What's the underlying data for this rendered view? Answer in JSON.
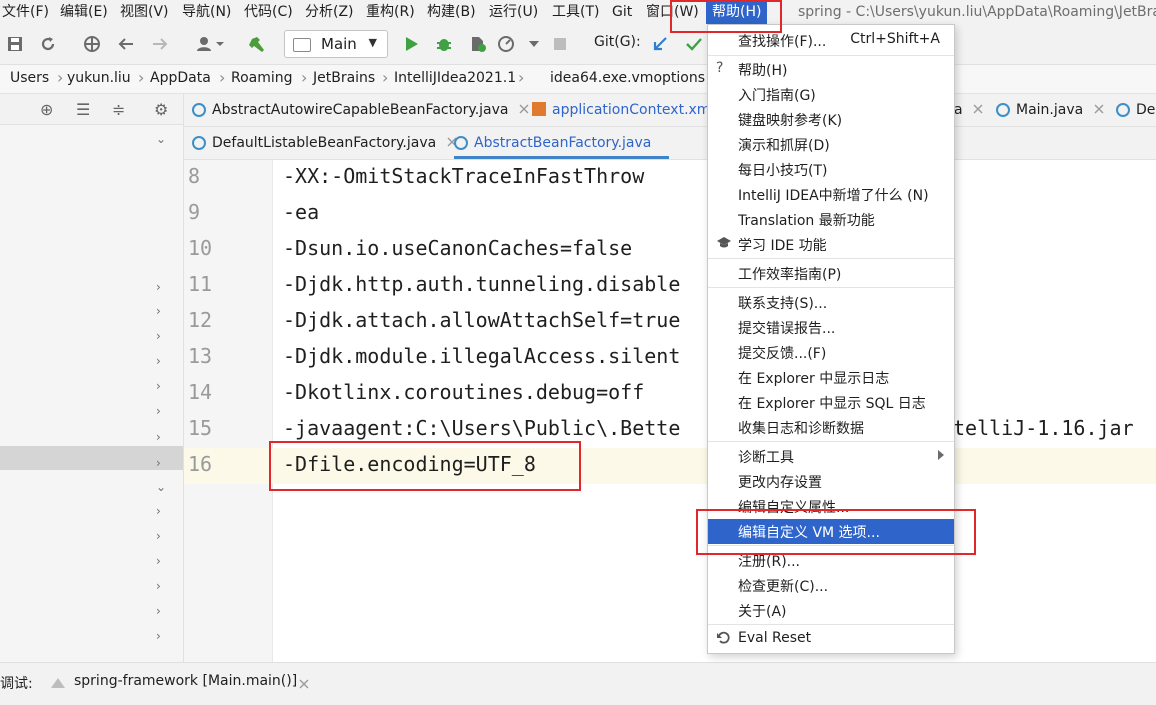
{
  "menubar": {
    "items": [
      "文件(F)",
      "编辑(E)",
      "视图(V)",
      "导航(N)",
      "代码(C)",
      "分析(Z)",
      "重构(R)",
      "构建(B)",
      "运行(U)",
      "工具(T)",
      "Git",
      "窗口(W)",
      "帮助(H)"
    ],
    "window_title": "spring - C:\\Users\\yukun.liu\\AppData\\Roaming\\JetBra"
  },
  "toolbar": {
    "run_config": "Main",
    "git_label": "Git(G):"
  },
  "breadcrumb": [
    "Users",
    "yukun.liu",
    "AppData",
    "Roaming",
    "JetBrains",
    "IntelliJIdea2021.1",
    "idea64.exe.vmoptions"
  ],
  "tabs_row1": [
    "AbstractAutowireCapableBeanFactory.java",
    "applicationContext.xm",
    "a",
    "Main.java",
    "De"
  ],
  "tabs_row2": [
    "DefaultListableBeanFactory.java",
    "AbstractBeanFactory.java"
  ],
  "editor": {
    "lines": [
      {
        "num": "8",
        "text": "-XX:-OmitStackTraceInFastThrow"
      },
      {
        "num": "9",
        "text": "-ea"
      },
      {
        "num": "10",
        "text": "-Dsun.io.useCanonCaches=false"
      },
      {
        "num": "11",
        "text": "-Djdk.http.auth.tunneling.disable"
      },
      {
        "num": "12",
        "text": "-Djdk.attach.allowAttachSelf=true"
      },
      {
        "num": "13",
        "text": "-Djdk.module.illegalAccess.silent"
      },
      {
        "num": "14",
        "text": "-Dkotlinx.coroutines.debug=off"
      },
      {
        "num": "15",
        "text": "-javaagent:C:\\Users\\Public\\.Bette"
      },
      {
        "num": "16",
        "text": "-Dfile.encoding=UTF_8"
      }
    ],
    "line15_tail": "telliJ-1.16.jar"
  },
  "help_menu": {
    "find_action": {
      "label": "查找操作(F)...",
      "shortcut": "Ctrl+Shift+A"
    },
    "items": [
      "帮助(H)",
      "入门指南(G)",
      "键盘映射参考(K)",
      "演示和抓屏(D)",
      "每日小技巧(T)",
      "IntelliJ IDEA中新增了什么 (N)",
      "Translation 最新功能",
      "学习 IDE 功能",
      "工作效率指南(P)",
      "联系支持(S)...",
      "提交错误报告...",
      "提交反馈...(F)",
      "在 Explorer 中显示日志",
      "在 Explorer 中显示 SQL 日志",
      "收集日志和诊断数据",
      "诊断工具",
      "更改内存设置",
      "编辑自定义属性...",
      "编辑自定义 VM 选项...",
      "注册(R)...",
      "检查更新(C)...",
      "关于(A)",
      "Eval Reset"
    ]
  },
  "bottom": {
    "debug_label": "调试:",
    "session": "spring-framework [Main.main()]"
  },
  "colors": {
    "accent": "#2f65ca",
    "highlight_red": "#e0272b",
    "current_line": "#fdf9e8"
  }
}
